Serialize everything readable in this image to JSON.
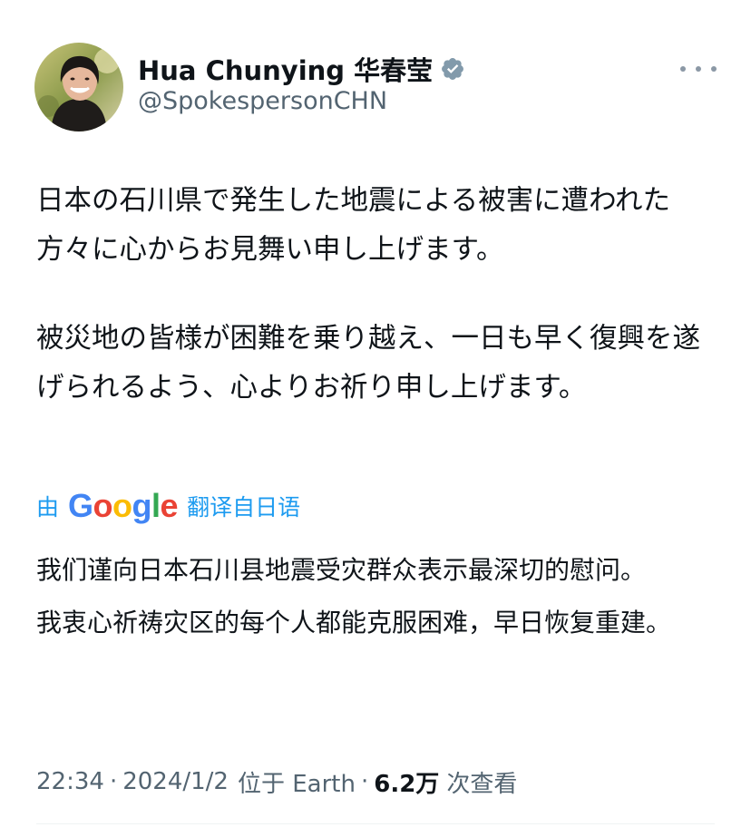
{
  "author": {
    "display_name": "Hua Chunying 华春莹",
    "handle": "@SpokespersonCHN",
    "verified_icon": "verified-badge-icon",
    "verified_color": "#829aab"
  },
  "tweet": {
    "paragraphs": [
      "日本の石川県で発生した地震による被害に遭われた方々に心からお見舞い申し上げます。",
      "被災地の皆様が困難を乗り越え、一日も早く復興を遂げられるよう、心よりお祈り申し上げます。"
    ]
  },
  "translate": {
    "prefix": "由",
    "provider": "Google",
    "suffix": "翻译自日语"
  },
  "translation": {
    "paragraphs": [
      "我们谨向日本石川县地震受灾群众表示最深切的慰问。",
      "我衷心祈祷灾区的每个人都能克服困难，早日恢复重建。"
    ]
  },
  "meta": {
    "time": "22:34",
    "date": "2024/1/2",
    "location": "位于 Earth",
    "views_count": "6.2万",
    "views_label": "次查看"
  },
  "colors": {
    "text": "#0f1419",
    "secondary": "#536471",
    "link": "#1d9bf0"
  }
}
